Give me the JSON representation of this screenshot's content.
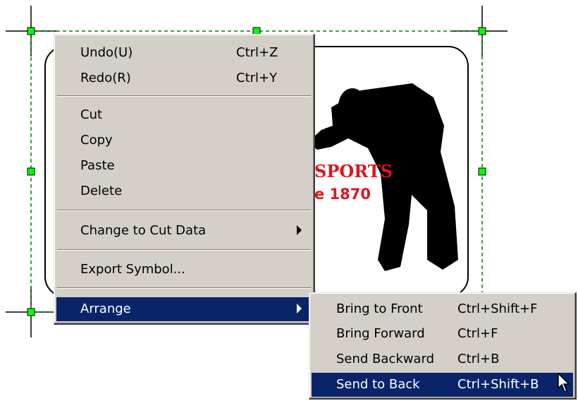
{
  "artwork": {
    "line1": "SPORTS",
    "line2": "e 1870",
    "text_color": "#e0141e"
  },
  "colors": {
    "handle": "#00ff00",
    "selection_dash": "#008000",
    "menu_face": "#d4d0c8",
    "menu_highlight": "#0a246a"
  },
  "context_menu": {
    "items": [
      {
        "label": "Undo(U)",
        "shortcut": "Ctrl+Z"
      },
      {
        "label": "Redo(R)",
        "shortcut": "Ctrl+Y"
      },
      {
        "label": "Cut"
      },
      {
        "label": "Copy"
      },
      {
        "label": "Paste"
      },
      {
        "label": "Delete"
      },
      {
        "label": "Change to Cut Data",
        "submenu": true
      },
      {
        "label": "Export Symbol..."
      },
      {
        "label": "Arrange",
        "submenu": true,
        "selected": true
      }
    ]
  },
  "submenu": {
    "items": [
      {
        "label": "Bring to Front",
        "shortcut": "Ctrl+Shift+F"
      },
      {
        "label": "Bring Forward",
        "shortcut": "Ctrl+F"
      },
      {
        "label": "Send Backward",
        "shortcut": "Ctrl+B"
      },
      {
        "label": "Send to Back",
        "shortcut": "Ctrl+Shift+B",
        "selected": true
      }
    ]
  },
  "cursor": {
    "icon": "arrow-pointer-icon"
  }
}
